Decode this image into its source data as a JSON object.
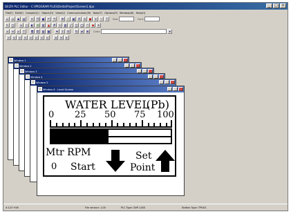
{
  "window": {
    "title": "DELTA PLC Editor - C:\\PROGRAM FILES\\Delta\\Project\\Screen1.dpa",
    "btn_min": "_",
    "btn_max": "□",
    "btn_close": "×"
  },
  "menu": [
    "File(F)",
    "Edit(E)",
    "Compile(C)",
    "Object(O)",
    "View(V)",
    "Communication(M)",
    "Tools(T)",
    "Options(P)",
    "Window(W)",
    "Help(H)"
  ],
  "toolbar": {
    "font_label": "Font:",
    "size_label": "Size:",
    "color_label": "Color:"
  },
  "windows": [
    {
      "title": "Window 1"
    },
    {
      "title": "Window 2"
    },
    {
      "title": "Window 3"
    },
    {
      "title": "Window 4"
    },
    {
      "title": "Window 5"
    },
    {
      "title": "Window 6 - Level Screen"
    }
  ],
  "screen": {
    "title": "WATER LEVEL",
    "unit": "(Pb)",
    "ticks": [
      "0",
      "25",
      "50",
      "75",
      "100"
    ],
    "level_percent": 48,
    "mtr_label": "Mtr RPM",
    "mtr_value": "0",
    "start_label": "Start",
    "set_label": "Set",
    "point_label": "Point"
  },
  "status": {
    "left": "X:123 Y:58",
    "file": "File version: 1.00",
    "plc": "PLC Type: DVP-14SS",
    "station": "Station Type: TP04G"
  },
  "colors": {
    "title_active": "#0a246a",
    "chrome": "#d4d0c8"
  }
}
